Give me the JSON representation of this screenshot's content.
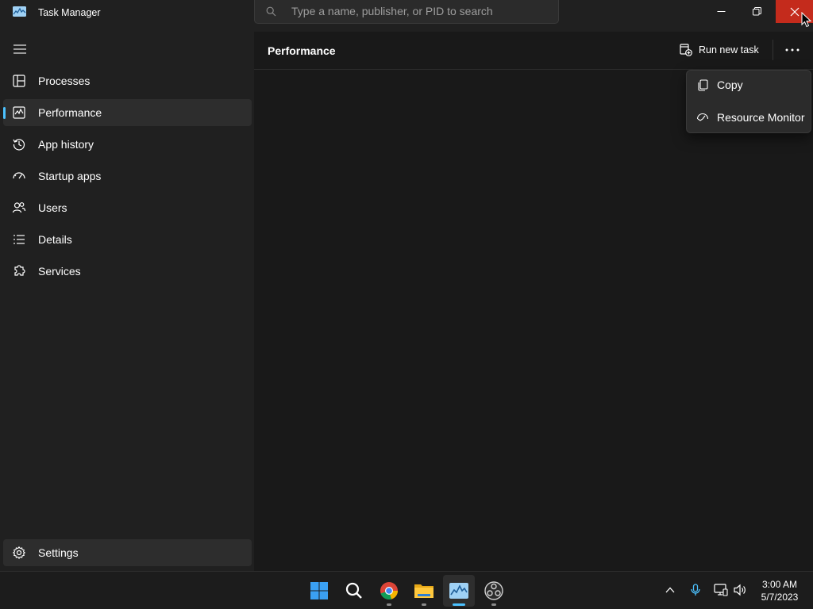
{
  "app": {
    "title": "Task Manager"
  },
  "search": {
    "placeholder": "Type a name, publisher, or PID to search"
  },
  "sidebar": {
    "items": [
      {
        "id": "processes",
        "label": "Processes",
        "icon": "processes-icon"
      },
      {
        "id": "performance",
        "label": "Performance",
        "icon": "performance-icon",
        "active": true
      },
      {
        "id": "app-history",
        "label": "App history",
        "icon": "history-icon"
      },
      {
        "id": "startup-apps",
        "label": "Startup apps",
        "icon": "speedometer-icon"
      },
      {
        "id": "users",
        "label": "Users",
        "icon": "users-icon"
      },
      {
        "id": "details",
        "label": "Details",
        "icon": "list-icon"
      },
      {
        "id": "services",
        "label": "Services",
        "icon": "puzzle-icon"
      }
    ],
    "settings": {
      "label": "Settings",
      "icon": "gear-icon"
    }
  },
  "main": {
    "title": "Performance",
    "run_task_label": "Run new task"
  },
  "menu": {
    "items": [
      {
        "label": "Copy",
        "icon": "copy-icon"
      },
      {
        "label": "Resource Monitor",
        "icon": "resource-monitor-icon"
      }
    ]
  },
  "taskbar": {
    "apps": [
      "start-icon",
      "search-icon",
      "chrome-icon",
      "file-explorer-icon",
      "task-manager-icon",
      "obs-icon"
    ],
    "time": "3:00 AM",
    "date": "5/7/2023"
  },
  "colors": {
    "accent": "#4cc2ff",
    "close_hover": "#c42b1c",
    "sidebar_bg": "#202020",
    "content_bg": "#191919"
  }
}
